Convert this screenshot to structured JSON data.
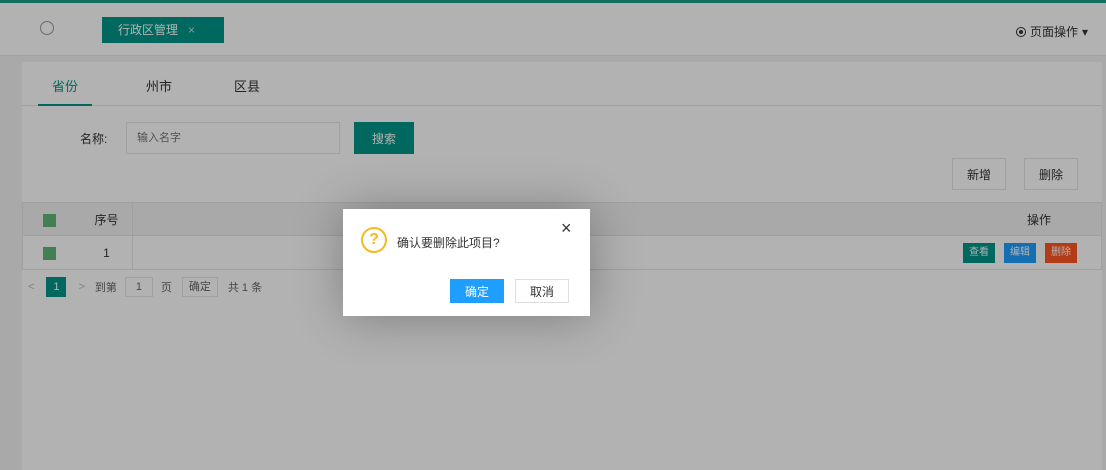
{
  "header": {
    "home_icon": "circle-home-icon",
    "tab_label": "行政区管理",
    "tab_close": "×",
    "page_ops_label": "页面操作",
    "page_ops_caret": "▾"
  },
  "subtabs": [
    "省份",
    "州市",
    "区县"
  ],
  "search": {
    "label": "名称:",
    "placeholder": "输入名字",
    "button": "搜索"
  },
  "toolbar": {
    "add_label": "新增",
    "delete_label": "删除"
  },
  "table": {
    "headers": {
      "no": "序号",
      "op": "操作"
    },
    "rows": [
      {
        "no": "1",
        "view": "查看",
        "edit": "编辑",
        "delete": "删除"
      }
    ]
  },
  "pager": {
    "prev": "<",
    "current": "1",
    "next": ">",
    "goto_label": "到第",
    "page_input": "1",
    "page_unit": "页",
    "confirm": "确定",
    "total": "共 1 条"
  },
  "dialog": {
    "icon": "?",
    "message": "确认要删除此项目?",
    "close": "×",
    "ok": "确定",
    "cancel": "取消"
  },
  "colors": {
    "primary": "#009688",
    "blue": "#1e9fff",
    "danger": "#ff5722",
    "warning": "#f7b824"
  }
}
